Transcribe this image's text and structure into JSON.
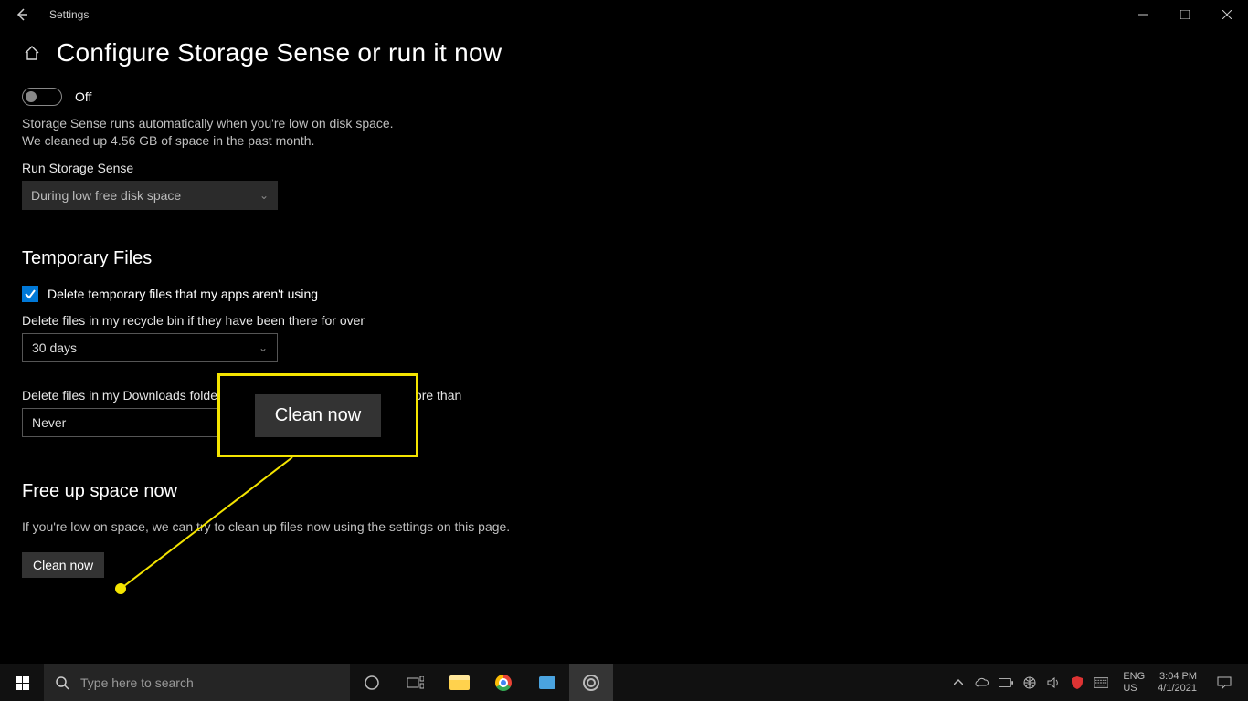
{
  "titlebar": {
    "app_title": "Settings"
  },
  "header": {
    "title": "Configure Storage Sense or run it now"
  },
  "storage_sense": {
    "toggle_label": "Off",
    "description": "Storage Sense runs automatically when you're low on disk space. We cleaned up 4.56 GB of space in the past month.",
    "schedule_label": "Run Storage Sense",
    "schedule_value": "During low free disk space"
  },
  "temp_files": {
    "section_title": "Temporary Files",
    "checkbox_label": "Delete temporary files that my apps aren't using",
    "recycle_label": "Delete files in my recycle bin if they have been there for over",
    "recycle_value": "30 days",
    "downloads_label": "Delete files in my Downloads folder if they haven't been opened for more than",
    "downloads_value": "Never"
  },
  "free_space": {
    "section_title": "Free up space now",
    "description": "If you're low on space, we can try to clean up files now using the settings on this page.",
    "button_label": "Clean now"
  },
  "callout": {
    "button_label": "Clean now"
  },
  "taskbar": {
    "search_placeholder": "Type here to search",
    "lang_top": "ENG",
    "lang_bottom": "US",
    "clock_time": "3:04 PM",
    "clock_date": "4/1/2021"
  }
}
